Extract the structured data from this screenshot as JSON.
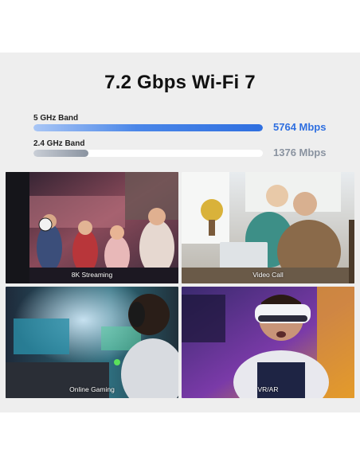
{
  "title": "7.2 Gbps Wi-Fi 7",
  "chart_data": {
    "type": "bar",
    "categories": [
      "5 GHz Band",
      "2.4 GHz Band"
    ],
    "values": [
      5764,
      1376
    ],
    "value_labels": [
      "5764 Mbps",
      "1376 Mbps"
    ],
    "colors": [
      "#2f6fe0",
      "#8a93a0"
    ]
  },
  "tiles": [
    {
      "caption": "8K Streaming"
    },
    {
      "caption": "Video Call"
    },
    {
      "caption": "Online Gaming"
    },
    {
      "caption": "VR/AR"
    }
  ],
  "colors": {
    "panel_bg": "#eeeeee",
    "accent_blue": "#2f6fe0",
    "muted_gray": "#8a93a0"
  }
}
